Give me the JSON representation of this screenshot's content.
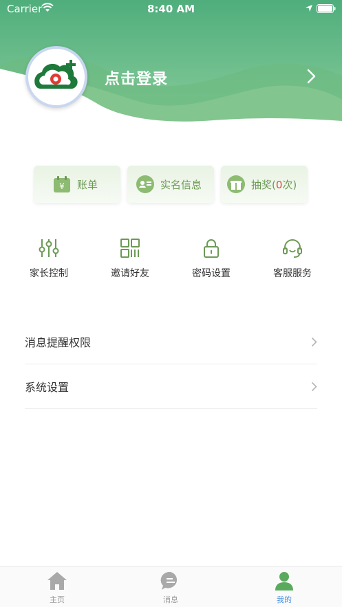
{
  "status_bar": {
    "carrier": "Carrier",
    "time": "8:40 AM"
  },
  "header": {
    "login_text": "点击登录"
  },
  "cards": [
    {
      "label": "账单",
      "icon": "calendar-yen-icon"
    },
    {
      "label": "实名信息",
      "icon": "id-card-icon"
    },
    {
      "label_prefix": "抽奖(",
      "count": "0",
      "label_suffix": "次)",
      "icon": "gift-icon"
    }
  ],
  "grid": [
    {
      "label": "家长控制",
      "icon": "sliders-icon"
    },
    {
      "label": "邀请好友",
      "icon": "qr-code-icon"
    },
    {
      "label": "密码设置",
      "icon": "lock-icon"
    },
    {
      "label": "客服服务",
      "icon": "headset-icon"
    }
  ],
  "list": [
    {
      "label": "消息提醒权限"
    },
    {
      "label": "系统设置"
    }
  ],
  "tabbar": [
    {
      "label": "主页",
      "icon": "home-icon"
    },
    {
      "label": "消息",
      "icon": "message-icon"
    },
    {
      "label": "我的",
      "icon": "user-icon",
      "active": true
    }
  ],
  "colors": {
    "primary_green": "#6c9a55",
    "accent_red": "#e3473b",
    "tab_active": "#4a90e2"
  }
}
